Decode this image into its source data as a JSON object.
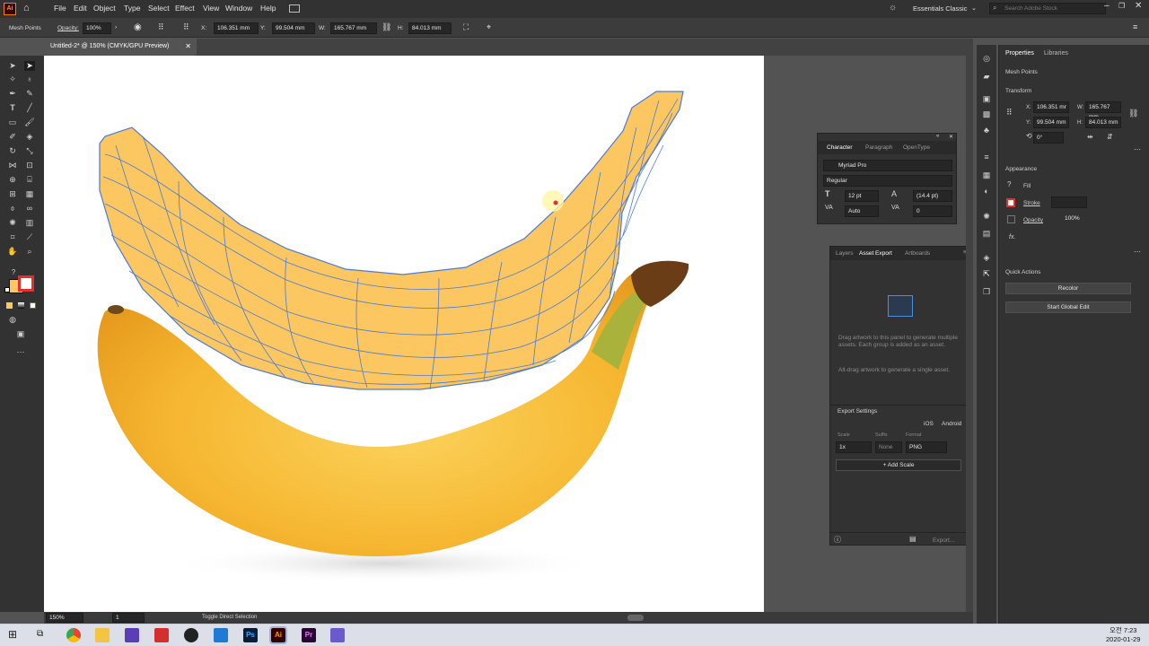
{
  "app": {
    "logo": "Ai",
    "menu": [
      "File",
      "Edit",
      "Object",
      "Type",
      "Select",
      "Effect",
      "View",
      "Window",
      "Help"
    ],
    "workspace": "Essentials Classic",
    "search_placeholder": "Search Adobe Stock"
  },
  "control": {
    "selection": "Mesh Points",
    "opacity_label": "Opacity:",
    "opacity": "100%",
    "x_label": "X:",
    "x": "106.351 mm",
    "y_label": "Y:",
    "y": "99.504 mm",
    "w_label": "W:",
    "w": "165.767 mm",
    "h_label": "H:",
    "h": "84.013 mm"
  },
  "document": {
    "tab": "Untitled-2* @ 150% (CMYK/GPU Preview)"
  },
  "status": {
    "zoom": "150%",
    "artboard": "1",
    "tool": "Toggle Direct Selection"
  },
  "character": {
    "tabs": [
      "Character",
      "Paragraph",
      "OpenType"
    ],
    "font": "Myriad Pro",
    "style": "Regular",
    "size": "12 pt",
    "leading": "(14.4 pt)",
    "kerning": "Auto",
    "tracking": "0"
  },
  "asset_export": {
    "tabs": [
      "Layers",
      "Asset Export",
      "Artboards"
    ],
    "hint1": "Drag artwork to this panel to generate multiple assets. Each group is added as an asset.",
    "hint2": "Alt-drag artwork to generate a single asset.",
    "settings": "Export Settings",
    "ios": "iOS",
    "android": "Android",
    "col_scale": "Scale",
    "col_suffix": "Suffix",
    "col_format": "Format",
    "scale": "1x",
    "suffix": "None",
    "format": "PNG",
    "add_scale": "+ Add Scale",
    "export": "Export..."
  },
  "properties": {
    "tabs": [
      "Properties",
      "Libraries"
    ],
    "selection": "Mesh Points",
    "transform": "Transform",
    "x_label": "X:",
    "x": "106.351 mr",
    "y_label": "Y:",
    "y": "99.504 mm",
    "w_label": "W:",
    "w": "165.767 mm",
    "h_label": "H:",
    "h": "84.013 mm",
    "rotate": "0°",
    "appearance": "Appearance",
    "fill": "Fill",
    "stroke": "Stroke",
    "opacity_label": "Opacity",
    "opacity": "100%",
    "fx": "fx.",
    "quick_actions": "Quick Actions",
    "recolor": "Recolor",
    "global_edit": "Start Global Edit"
  },
  "taskbar": {
    "time": "오전 7:23",
    "date": "2020-01-29"
  },
  "colors": {
    "mesh": "#4a7bd8",
    "fill": "#fcc760",
    "banana": "#f5b82e"
  }
}
